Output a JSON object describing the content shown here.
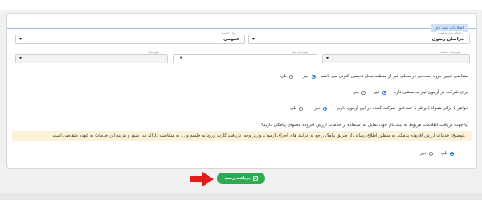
{
  "top_strip": {
    "placeholder": "..."
  },
  "section_title": "اطلاعات ثبت نام",
  "fields": {
    "province": {
      "label": "استان محل سکونت",
      "value": "خراسان رضوی"
    },
    "gender_type": {
      "label": "نوع / جنسیت",
      "value": "عمومی"
    },
    "field1": {
      "label": "شهرستان محل تحصیل",
      "value": "۲"
    },
    "field2": {
      "label": "شهرستان تولد",
      "value": "۲"
    },
    "field3": {
      "label": "شهرستان سکونت",
      "value": ""
    },
    "field4": {
      "label": "شهرستان",
      "value": ""
    }
  },
  "questions": [
    {
      "text": "متقاضی تغییر حوزه امتحانی در محلی غیر از منطقه محل تحصیل کنونی می باشم",
      "options": [
        "خیر",
        "بلی"
      ],
      "selected": "خیر"
    },
    {
      "text": "برای شرکت در آزمون نیاز به منشی دارم",
      "options": [
        "خیر",
        "بلی"
      ],
      "selected": "خیر"
    },
    {
      "text": "خواهر یا برادر همزاد (دوقلو یا چند قلو) شرکت کننده در این آزمون دارم",
      "options": [
        "خیر",
        "بلی"
      ],
      "selected": "خیر"
    },
    {
      "text": "آیا جهت دریافت اطلاعات مربوط به ثبت نام خود، تمایل به استفاده از خدمات ارزش افزوده محتوای پیامکی دارید؟",
      "options": [
        "خیر",
        "بلی"
      ],
      "selected": "بلی"
    }
  ],
  "note": "توضیح: خدمات ارزش افزوده پیامکی به منظور اطلاع رسانی از طریق پیامک راجع به فرایند های اجرای آزمون، واریز وجه، دریافت کارت ورود به جلسه و ... به متقاضیان ارائه می شود و هزینه این خدمات به عهده متقاضی است.",
  "submit_label": "دریافت رسید",
  "icons": {
    "submit": "receipt-icon",
    "chevron": "chevron-down-icon",
    "arrow": "red-arrow-icon"
  },
  "colors": {
    "accent": "#2eaa53",
    "note_bg": "#fdf2d6",
    "arrow": "#e21b1b",
    "radio": "#1a73e8"
  }
}
